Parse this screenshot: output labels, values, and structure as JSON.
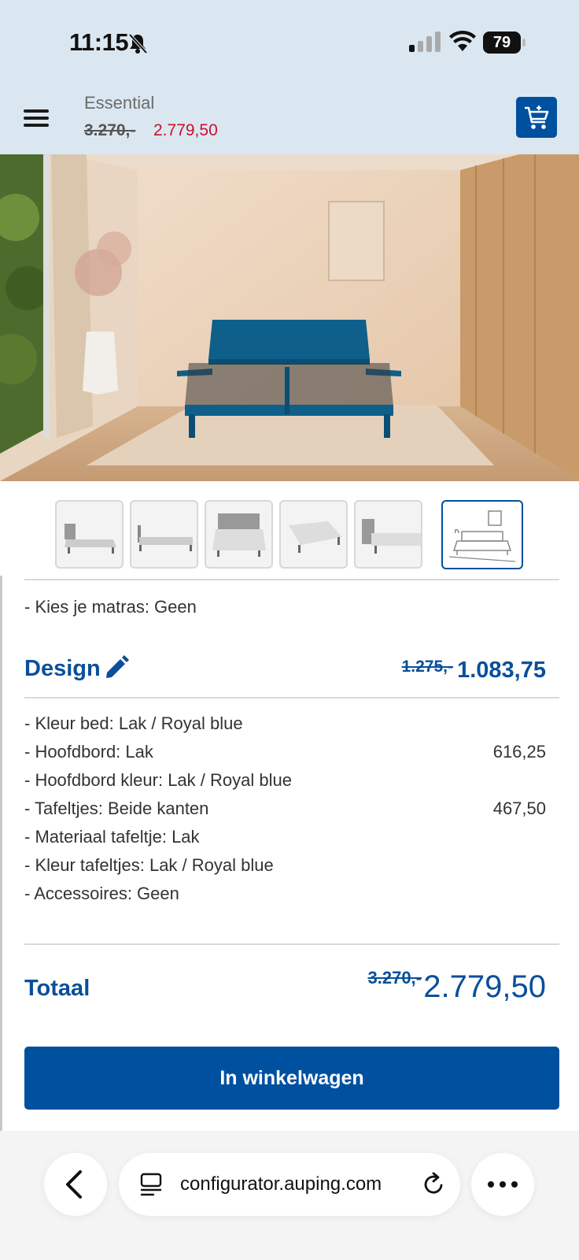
{
  "status_bar": {
    "time": "11:15",
    "battery": "79"
  },
  "header": {
    "product_name": "Essential",
    "old_price": "3.270,-",
    "new_price": "2.779,50"
  },
  "matras_line": "- Kies je matras: Geen",
  "design": {
    "title": "Design",
    "old_price": "1.275,-",
    "new_price": "1.083,75",
    "items": [
      {
        "label": "- Kleur bed: Lak / Royal blue",
        "price": ""
      },
      {
        "label": "- Hoofdbord: Lak",
        "price": "616,25"
      },
      {
        "label": "- Hoofdbord kleur: Lak / Royal blue",
        "price": ""
      },
      {
        "label": "- Tafeltjes: Beide kanten",
        "price": "467,50"
      },
      {
        "label": "- Materiaal tafeltje: Lak",
        "price": ""
      },
      {
        "label": "- Kleur tafeltjes: Lak / Royal blue",
        "price": ""
      },
      {
        "label": "- Accessoires: Geen",
        "price": ""
      }
    ]
  },
  "total": {
    "label": "Totaal",
    "old_price": "3.270,-",
    "new_price": "2.779,50"
  },
  "cta": {
    "label": "In winkelwagen"
  },
  "browser": {
    "url": "configurator.auping.com"
  },
  "colors": {
    "brand_blue": "#0050a0",
    "title_blue": "#0a4f9a",
    "sale_red": "#c8102e",
    "bed_blue": "#0e5f8a"
  },
  "icons": [
    "bell-off-icon",
    "signal-icon",
    "wifi-icon",
    "battery-icon",
    "menu-icon",
    "cart-add-icon",
    "pencil-icon",
    "back-icon",
    "tabs-icon",
    "reload-icon",
    "more-icon"
  ]
}
